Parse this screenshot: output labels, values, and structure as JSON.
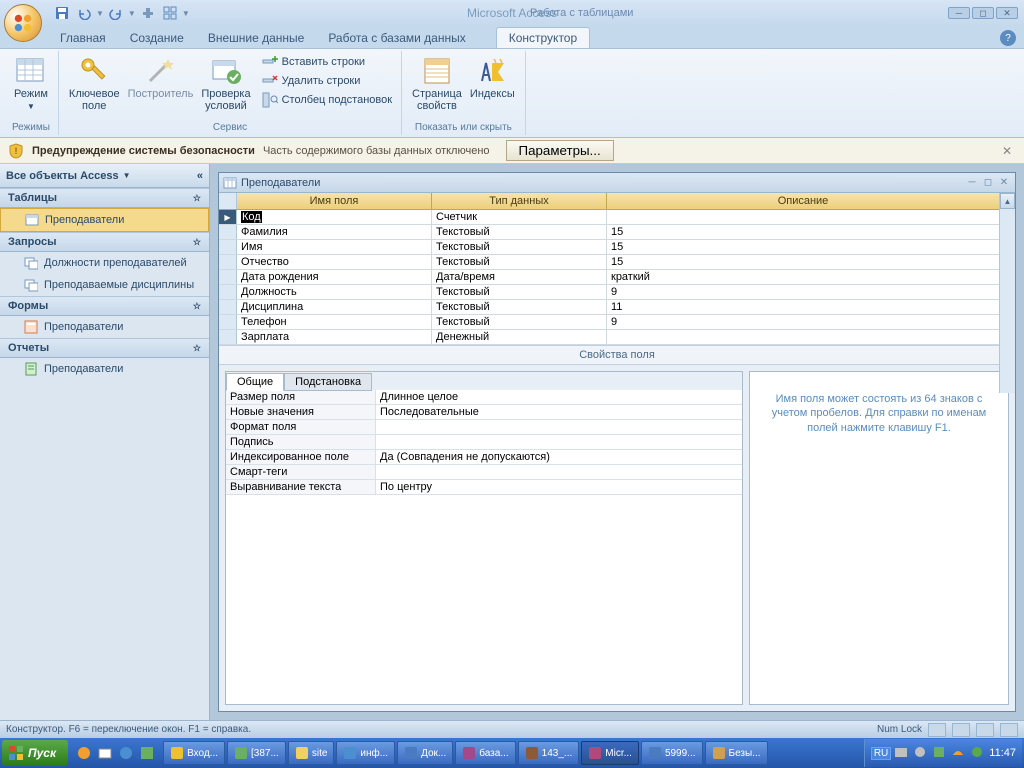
{
  "app": {
    "title": "Microsoft Access",
    "context_tab_group": "Работа с таблицами"
  },
  "tabs": {
    "items": [
      "Главная",
      "Создание",
      "Внешние данные",
      "Работа с базами данных"
    ],
    "context": "Конструктор"
  },
  "ribbon": {
    "groups": {
      "modes": {
        "label": "Режимы",
        "mode_btn": "Режим"
      },
      "service": {
        "label": "Сервис",
        "key_field": "Ключевое\nполе",
        "builder": "Построитель",
        "validation": "Проверка\nусловий",
        "insert_rows": "Вставить строки",
        "delete_rows": "Удалить строки",
        "lookup_col": "Столбец подстановок"
      },
      "show_hide": {
        "label": "Показать или скрыть",
        "prop_sheet": "Страница\nсвойств",
        "indexes": "Индексы"
      }
    }
  },
  "security": {
    "title": "Предупреждение системы безопасности",
    "msg": "Часть содержимого базы данных отключено",
    "params_btn": "Параметры..."
  },
  "nav": {
    "header": "Все объекты Access",
    "sections": [
      {
        "label": "Таблицы",
        "items": [
          "Преподаватели"
        ]
      },
      {
        "label": "Запросы",
        "items": [
          "Должности преподавателей",
          "Преподаваемые дисциплины"
        ]
      },
      {
        "label": "Формы",
        "items": [
          "Преподаватели"
        ]
      },
      {
        "label": "Отчеты",
        "items": [
          "Преподаватели"
        ]
      }
    ]
  },
  "table_window": {
    "title": "Преподаватели",
    "headers": {
      "field_name": "Имя поля",
      "data_type": "Тип данных",
      "description": "Описание"
    },
    "rows": [
      {
        "name": "Код",
        "type": "Счетчик",
        "desc": "",
        "active": true
      },
      {
        "name": "Фамилия",
        "type": "Текстовый",
        "desc": "15"
      },
      {
        "name": "Имя",
        "type": "Текстовый",
        "desc": "15"
      },
      {
        "name": "Отчество",
        "type": "Текстовый",
        "desc": "15"
      },
      {
        "name": "Дата рождения",
        "type": "Дата/время",
        "desc": "краткий"
      },
      {
        "name": "Должность",
        "type": "Текстовый",
        "desc": "9"
      },
      {
        "name": "Дисциплина",
        "type": "Текстовый",
        "desc": "11"
      },
      {
        "name": "Телефон",
        "type": "Текстовый",
        "desc": "9"
      },
      {
        "name": "Зарплата",
        "type": "Денежный",
        "desc": ""
      }
    ],
    "field_props_label": "Свойства поля"
  },
  "props": {
    "tabs": {
      "general": "Общие",
      "lookup": "Подстановка"
    },
    "rows": [
      {
        "label": "Размер поля",
        "value": "Длинное целое"
      },
      {
        "label": "Новые значения",
        "value": "Последовательные"
      },
      {
        "label": "Формат поля",
        "value": ""
      },
      {
        "label": "Подпись",
        "value": ""
      },
      {
        "label": "Индексированное поле",
        "value": "Да (Совпадения не допускаются)"
      },
      {
        "label": "Смарт-теги",
        "value": ""
      },
      {
        "label": "Выравнивание текста",
        "value": "По центру"
      }
    ],
    "help": "Имя поля может состоять из 64 знаков с учетом пробелов.  Для справки по именам полей нажмите клавишу F1."
  },
  "statusbar": {
    "left": "Конструктор.  F6 = переключение окон.  F1 = справка.",
    "numlock": "Num Lock"
  },
  "taskbar": {
    "start": "Пуск",
    "tasks": [
      "Вход...",
      "[387...",
      "site",
      "инф...",
      "Док...",
      "база...",
      "143_...",
      "Micr...",
      "5999...",
      "Безы..."
    ],
    "active_index": 7,
    "lang": "RU",
    "clock": "11:47"
  }
}
